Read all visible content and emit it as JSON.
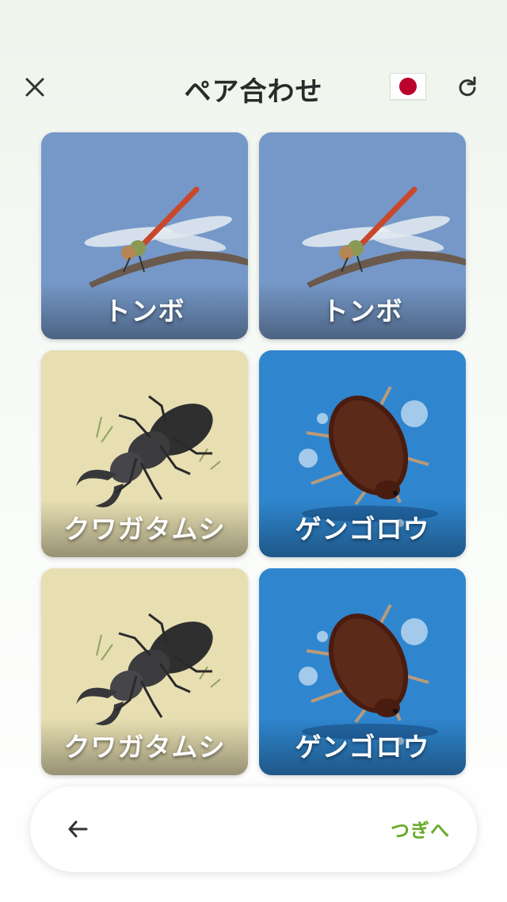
{
  "header": {
    "title": "ペア合わせ",
    "close_icon": "close-icon",
    "flag_icon": "japan-flag-icon",
    "refresh_icon": "refresh-icon",
    "flag_color": "#bc002d"
  },
  "cards": [
    {
      "label": "トンボ",
      "image": "dragonfly",
      "bg": "#7598c8"
    },
    {
      "label": "トンボ",
      "image": "dragonfly",
      "bg": "#7598c8"
    },
    {
      "label": "クワガタムシ",
      "image": "stag-beetle",
      "bg": "#e7dfb2"
    },
    {
      "label": "ゲンゴロウ",
      "image": "diving-beetle",
      "bg": "#2f86cf"
    },
    {
      "label": "クワガタムシ",
      "image": "stag-beetle",
      "bg": "#e7dfb2"
    },
    {
      "label": "ゲンゴロウ",
      "image": "diving-beetle",
      "bg": "#2f86cf"
    }
  ],
  "footer": {
    "back_icon": "arrow-left-icon",
    "next_label": "つぎへ",
    "next_color": "#6aaa2a"
  }
}
